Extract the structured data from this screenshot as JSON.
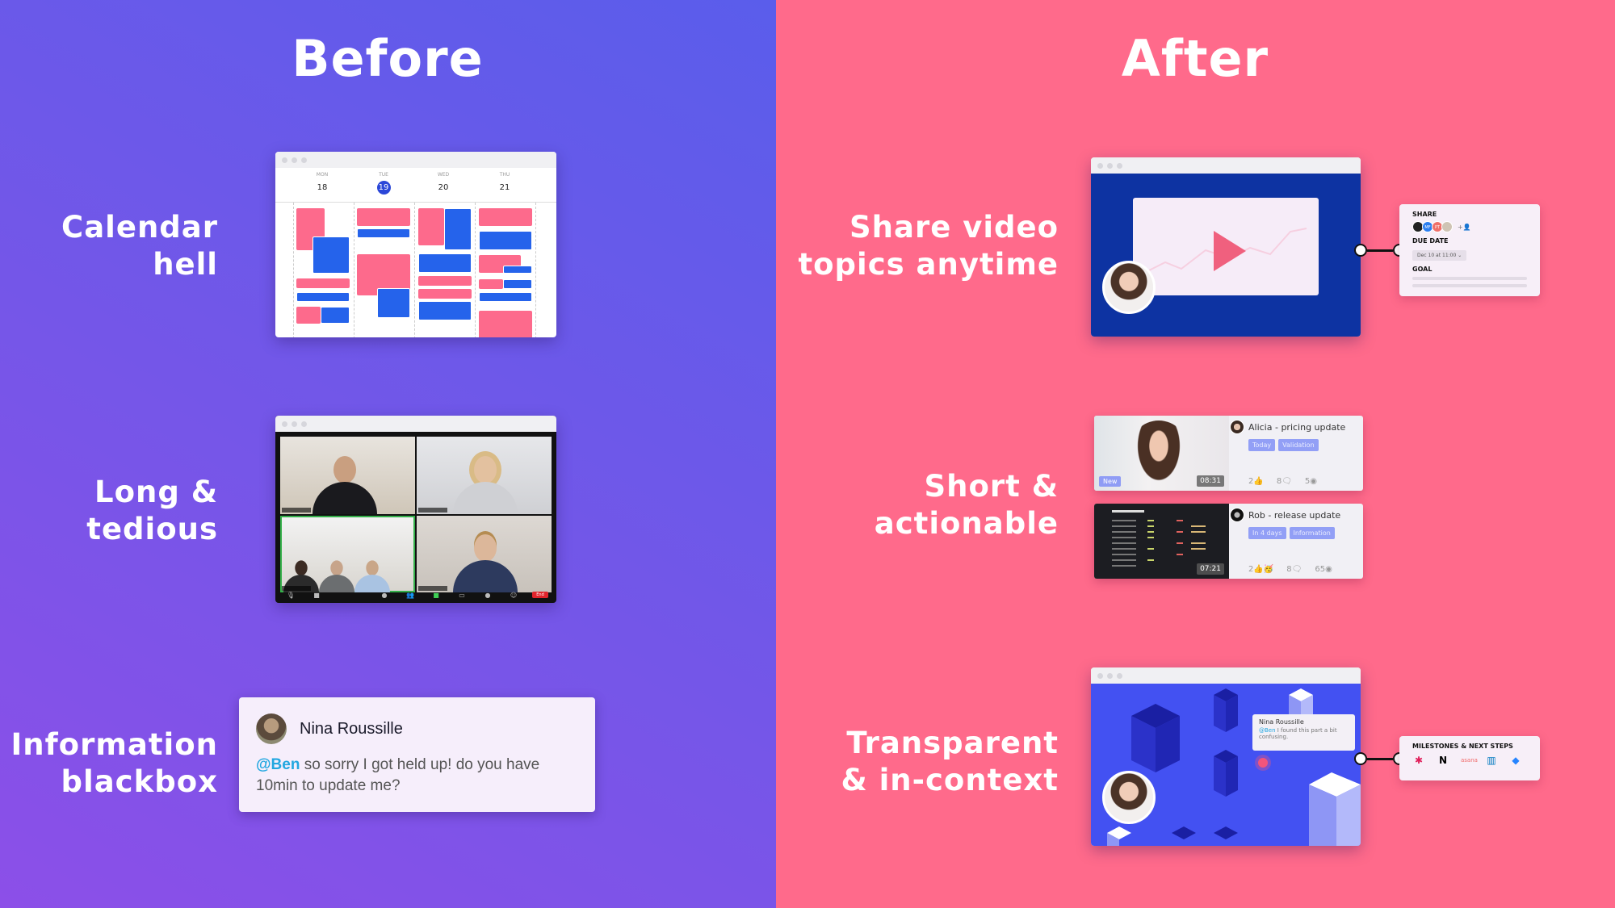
{
  "before": {
    "title": "Before",
    "rows": [
      {
        "label_lines": [
          "Calendar",
          "hell"
        ]
      },
      {
        "label_lines": [
          "Long &",
          "tedious"
        ]
      },
      {
        "label_lines": [
          "Information",
          "blackbox"
        ]
      }
    ],
    "calendar": {
      "days": [
        {
          "dow": "MON",
          "date": "18",
          "today": false
        },
        {
          "dow": "TUE",
          "date": "19",
          "today": true
        },
        {
          "dow": "WED",
          "date": "20",
          "today": false
        },
        {
          "dow": "THU",
          "date": "21",
          "today": false
        }
      ]
    },
    "meeting": {
      "controls": [
        "Mute",
        "Stop Video",
        "Security",
        "Participants",
        "Share screen",
        "Chat",
        "Record",
        "Reactions"
      ],
      "end_label": "End"
    },
    "chat": {
      "author": "Nina Roussille",
      "mention": "@Ben",
      "message": " so sorry I got held up! do you have 10min to update me?"
    }
  },
  "after": {
    "title": "After",
    "rows": [
      {
        "label_lines": [
          "Share video",
          "topics anytime"
        ]
      },
      {
        "label_lines": [
          "Short &",
          "actionable"
        ]
      },
      {
        "label_lines": [
          "Transparent",
          "& in-context"
        ]
      }
    ],
    "share_card": {
      "share_label": "SHARE",
      "avatars": [
        "",
        "MF",
        "PT",
        ""
      ],
      "due_date_label": "DUE DATE",
      "due_date_value": "Dec 10 at 11:00",
      "goal_label": "GOAL"
    },
    "videos": [
      {
        "title": "Alicia - pricing update",
        "tags": [
          "Today",
          "Validation"
        ],
        "duration": "08:31",
        "badge": "New",
        "reactions": "2",
        "comments": "8",
        "views": "5"
      },
      {
        "title": "Rob - release update",
        "tags": [
          "In 4 days",
          "Information"
        ],
        "duration": "07:21",
        "badge": "",
        "reactions": "2",
        "comments": "8",
        "views": "65"
      }
    ],
    "context_comment": {
      "author": "Nina Roussille",
      "mention": "@Ben",
      "message": " I found this part a bit confusing."
    },
    "milestones_card": {
      "label": "MILESTONES & NEXT STEPS",
      "integrations": [
        "slack",
        "notion",
        "asana",
        "trello",
        "jira"
      ]
    }
  },
  "colors": {
    "before_bg_start": "#8c4fe8",
    "before_bg_end": "#5a5deb",
    "after_bg": "#ff6a8b",
    "event_pink": "#fd6a8c",
    "event_blue": "#2563eb",
    "today_blue": "#2b47d8",
    "mention_blue": "#22a7e0"
  }
}
